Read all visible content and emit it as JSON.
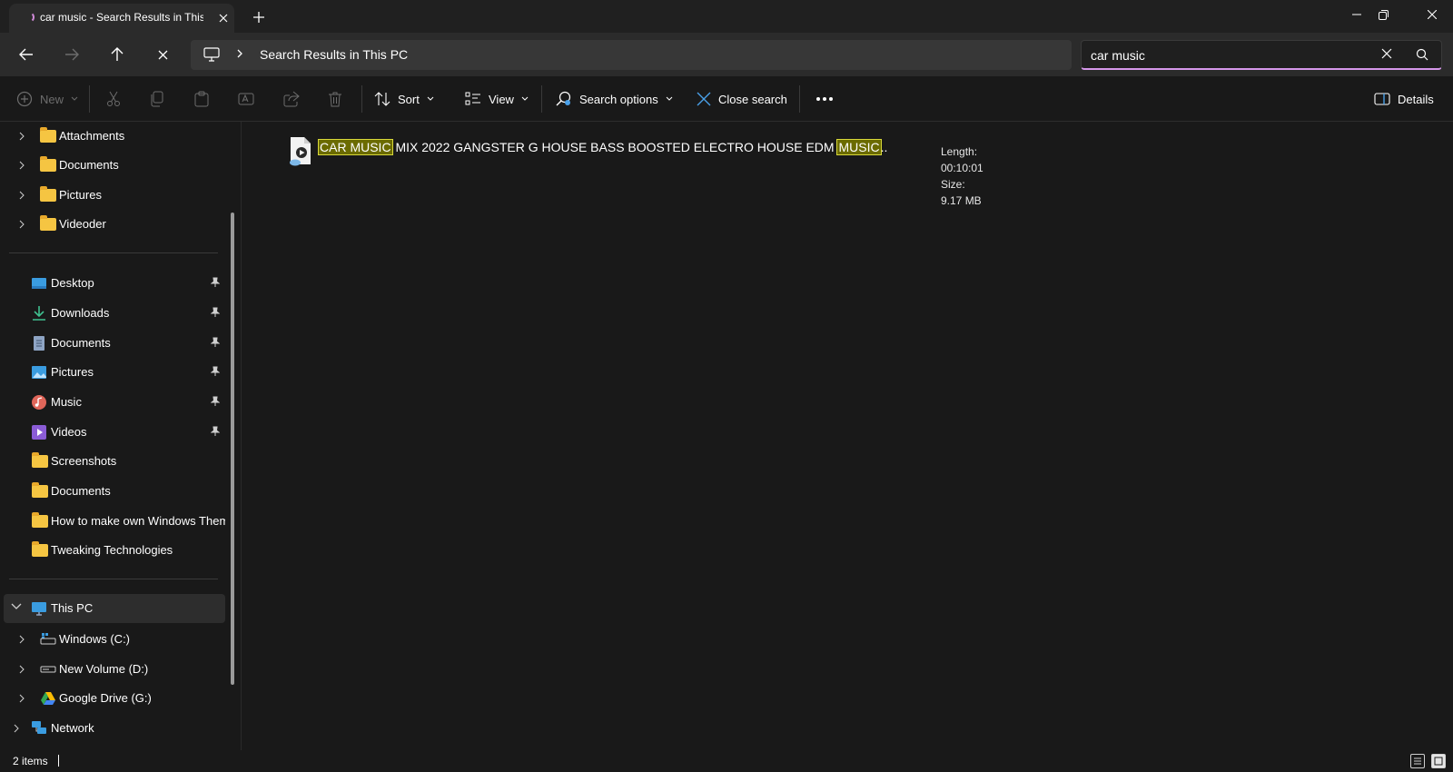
{
  "tab": {
    "title": "car music - Search Results in This PC",
    "close_icon": "close-icon",
    "new_tab_icon": "plus-icon"
  },
  "window_controls": [
    "minimize",
    "restore",
    "close"
  ],
  "navigation": {
    "back_icon": "arrow-left-icon",
    "forward_icon": "arrow-right-icon",
    "up_icon": "arrow-up-icon",
    "stop_icon": "close-icon"
  },
  "address": {
    "path": "Search Results in This PC"
  },
  "search": {
    "value": "car music",
    "accent": "#d597ea"
  },
  "toolbar": {
    "new_label": "New",
    "sort_label": "Sort",
    "view_label": "View",
    "search_options_label": "Search options",
    "close_search_label": "Close search",
    "details_label": "Details"
  },
  "sidebar": {
    "top_items": [
      {
        "label": "Attachments"
      },
      {
        "label": "Documents"
      },
      {
        "label": "Pictures"
      },
      {
        "label": "Videoder"
      }
    ],
    "quick_access": [
      {
        "label": "Desktop",
        "icon": "desktop-icon",
        "pinned": true
      },
      {
        "label": "Downloads",
        "icon": "download-icon",
        "pinned": true
      },
      {
        "label": "Documents",
        "icon": "document-icon",
        "pinned": true
      },
      {
        "label": "Pictures",
        "icon": "pictures-icon",
        "pinned": true
      },
      {
        "label": "Music",
        "icon": "music-icon",
        "pinned": true
      },
      {
        "label": "Videos",
        "icon": "videos-icon",
        "pinned": true
      },
      {
        "label": "Screenshots",
        "icon": "folder-icon",
        "pinned": false
      },
      {
        "label": "Documents",
        "icon": "folder-icon",
        "pinned": false
      },
      {
        "label": "How to make own Windows Theme",
        "icon": "folder-icon",
        "pinned": false
      },
      {
        "label": "Tweaking Technologies",
        "icon": "folder-icon",
        "pinned": false
      }
    ],
    "this_pc": {
      "label": "This PC",
      "drives": [
        {
          "label": "Windows (C:)",
          "icon": "windows-drive-icon"
        },
        {
          "label": "New Volume (D:)",
          "icon": "drive-icon"
        },
        {
          "label": "Google Drive (G:)",
          "icon": "google-drive-icon"
        }
      ]
    },
    "network": {
      "label": "Network"
    }
  },
  "results": [
    {
      "name_hl1": "CAR MUSIC",
      "name_mid": " MIX 2022 GANGSTER G HOUSE BASS BOOSTED ELECTRO HOUSE EDM ",
      "name_hl2": "MUSIC",
      "name_tail": "..",
      "length": "Length: 00:10:01",
      "size": "Size: 9.17 MB",
      "highlight_color": "#6b6b00"
    }
  ],
  "status": {
    "count": "2 items"
  }
}
